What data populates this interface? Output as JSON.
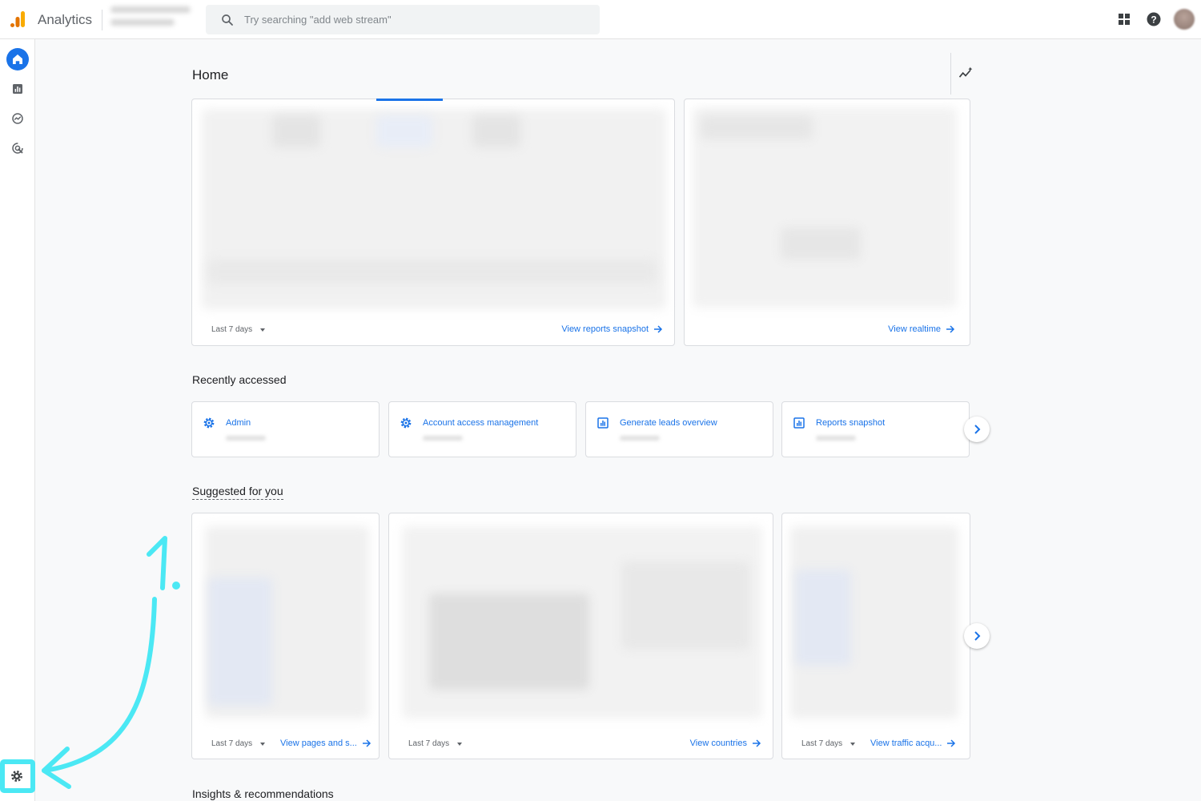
{
  "header": {
    "app_title": "Analytics",
    "search_placeholder": "Try searching \"add web stream\""
  },
  "icons": {
    "logo": "analytics-logo-icon",
    "search": "search-icon",
    "apps": "apps-grid-icon",
    "help": "help-icon",
    "home": "home-icon",
    "reports": "reports-icon",
    "explore": "explore-icon",
    "advertising": "advertising-icon",
    "admin": "gear-icon",
    "insights": "insights-icon"
  },
  "colors": {
    "accent": "#1a73e8",
    "logo_dark": "#e37400",
    "logo_light": "#f9ab00",
    "annotation": "#4be8f4"
  },
  "main": {
    "title": "Home",
    "overview_card": {
      "period_label": "Last 7 days",
      "link_label": "View reports snapshot"
    },
    "realtime_card": {
      "link_label": "View realtime"
    },
    "recently_accessed": {
      "title": "Recently accessed",
      "items": [
        {
          "label": "Admin",
          "icon": "gear-icon"
        },
        {
          "label": "Account access management",
          "icon": "gear-icon"
        },
        {
          "label": "Generate leads overview",
          "icon": "report-icon"
        },
        {
          "label": "Reports snapshot",
          "icon": "report-icon"
        }
      ]
    },
    "suggested": {
      "title": "Suggested for you",
      "cards": [
        {
          "period_label": "Last 7 days",
          "link_label": "View pages and s..."
        },
        {
          "period_label": "Last 7 days",
          "link_label": "View countries"
        },
        {
          "period_label": "Last 7 days",
          "link_label": "View traffic acqu..."
        }
      ]
    },
    "insights_title": "Insights & recommendations"
  },
  "annotation": {
    "label": "1."
  }
}
